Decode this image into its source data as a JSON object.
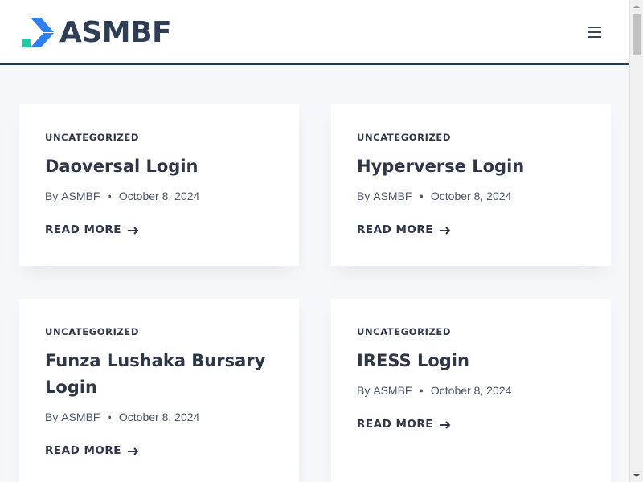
{
  "brand": {
    "name": "ASMBF",
    "colors": {
      "mark_blue": "#2f7ff0",
      "mark_green": "#21c9a6",
      "text": "#2f3e55"
    }
  },
  "header": {
    "menu_icon": "hamburger-menu-icon"
  },
  "posts": [
    {
      "category": "UNCATEGORIZED",
      "title": "Daoversal Login",
      "author_prefix": "By",
      "author": "ASMBF",
      "date": "October 8, 2024",
      "read_more": "READ MORE"
    },
    {
      "category": "UNCATEGORIZED",
      "title": "Hyperverse Login",
      "author_prefix": "By",
      "author": "ASMBF",
      "date": "October 8, 2024",
      "read_more": "READ MORE"
    },
    {
      "category": "UNCATEGORIZED",
      "title": "Funza Lushaka Bursary Login",
      "author_prefix": "By",
      "author": "ASMBF",
      "date": "October 8, 2024",
      "read_more": "READ MORE"
    },
    {
      "category": "UNCATEGORIZED",
      "title": "IRESS Login",
      "author_prefix": "By",
      "author": "ASMBF",
      "date": "October 8, 2024",
      "read_more": "READ MORE"
    }
  ]
}
